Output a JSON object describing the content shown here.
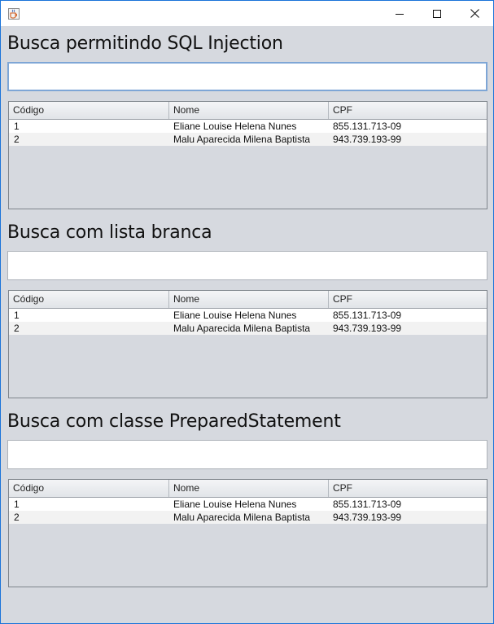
{
  "window": {
    "icon": "java-cup-icon",
    "title": "",
    "controls": [
      "minimize-icon",
      "maximize-icon",
      "close-icon"
    ]
  },
  "columns": [
    "Código",
    "Nome",
    "CPF"
  ],
  "sections": [
    {
      "title": "Busca permitindo SQL Injection",
      "search_value": "",
      "rows": [
        [
          "1",
          "Eliane Louise Helena Nunes",
          "855.131.713-09"
        ],
        [
          "2",
          "Malu Aparecida Milena Baptista",
          "943.739.193-99"
        ]
      ]
    },
    {
      "title": "Busca com lista branca",
      "search_value": "",
      "rows": [
        [
          "1",
          "Eliane Louise Helena Nunes",
          "855.131.713-09"
        ],
        [
          "2",
          "Malu Aparecida Milena Baptista",
          "943.739.193-99"
        ]
      ]
    },
    {
      "title": "Busca com classe PreparedStatement",
      "search_value": "",
      "rows": [
        [
          "1",
          "Eliane Louise Helena Nunes",
          "855.131.713-09"
        ],
        [
          "2",
          "Malu Aparecida Milena Baptista",
          "943.739.193-99"
        ]
      ]
    }
  ]
}
